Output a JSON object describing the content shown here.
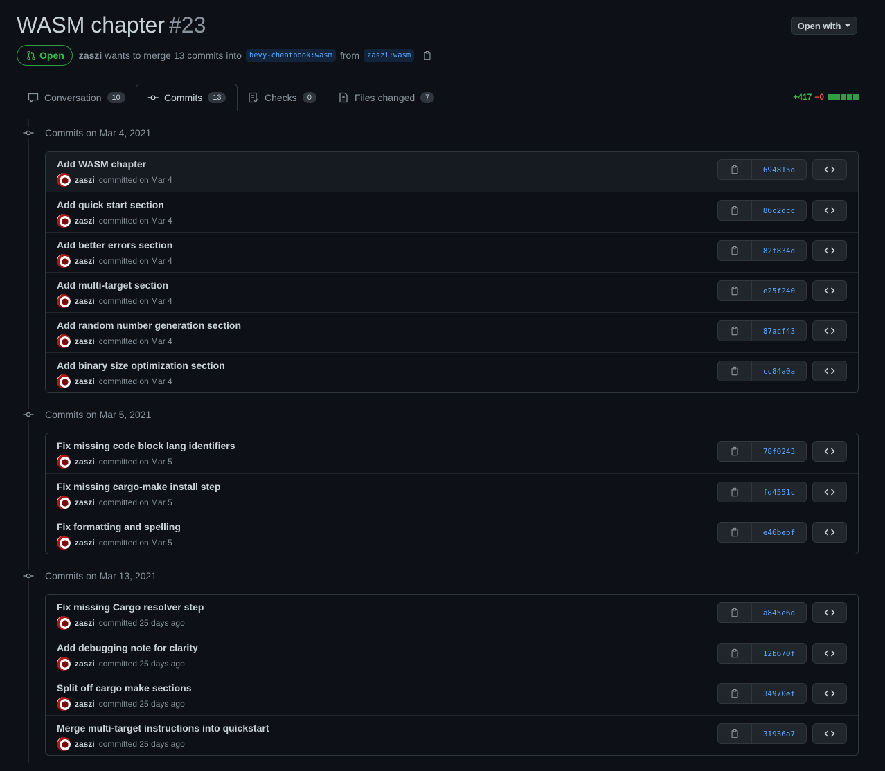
{
  "pr": {
    "title": "WASM chapter",
    "number": "#23",
    "state": "Open",
    "author": "zaszi",
    "merge_text": "wants to merge 13 commits into",
    "base_branch": "bevy-cheatbook:wasm",
    "from_text": "from",
    "head_branch": "zaszi:wasm"
  },
  "header": {
    "open_with_label": "Open with"
  },
  "tabs": [
    {
      "label": "Conversation",
      "count": "10",
      "icon": "comment-icon"
    },
    {
      "label": "Commits",
      "count": "13",
      "icon": "git-commit-icon"
    },
    {
      "label": "Checks",
      "count": "0",
      "icon": "checklist-icon"
    },
    {
      "label": "Files changed",
      "count": "7",
      "icon": "file-diff-icon"
    }
  ],
  "diffstat": {
    "additions": "+417",
    "deletions": "−0",
    "color_add": "#3fb950",
    "color_del": "#f85149"
  },
  "groups": [
    {
      "heading": "Commits on Mar 4, 2021",
      "commits": [
        {
          "message": "Add WASM chapter",
          "author": "zaszi",
          "time": "committed on Mar 4",
          "sha": "694815d"
        },
        {
          "message": "Add quick start section",
          "author": "zaszi",
          "time": "committed on Mar 4",
          "sha": "86c2dcc"
        },
        {
          "message": "Add better errors section",
          "author": "zaszi",
          "time": "committed on Mar 4",
          "sha": "82f834d"
        },
        {
          "message": "Add multi-target section",
          "author": "zaszi",
          "time": "committed on Mar 4",
          "sha": "e25f240"
        },
        {
          "message": "Add random number generation section",
          "author": "zaszi",
          "time": "committed on Mar 4",
          "sha": "87acf43"
        },
        {
          "message": "Add binary size optimization section",
          "author": "zaszi",
          "time": "committed on Mar 4",
          "sha": "cc84a0a"
        }
      ]
    },
    {
      "heading": "Commits on Mar 5, 2021",
      "commits": [
        {
          "message": "Fix missing code block lang identifiers",
          "author": "zaszi",
          "time": "committed on Mar 5",
          "sha": "78f0243"
        },
        {
          "message": "Fix missing cargo-make install step",
          "author": "zaszi",
          "time": "committed on Mar 5",
          "sha": "fd4551c"
        },
        {
          "message": "Fix formatting and spelling",
          "author": "zaszi",
          "time": "committed on Mar 5",
          "sha": "e46bebf"
        }
      ]
    },
    {
      "heading": "Commits on Mar 13, 2021",
      "commits": [
        {
          "message": "Fix missing Cargo resolver step",
          "author": "zaszi",
          "time": "committed 25 days ago",
          "sha": "a845e6d"
        },
        {
          "message": "Add debugging note for clarity",
          "author": "zaszi",
          "time": "committed 25 days ago",
          "sha": "12b670f"
        },
        {
          "message": "Split off cargo make sections",
          "author": "zaszi",
          "time": "committed 25 days ago",
          "sha": "34970ef"
        },
        {
          "message": "Merge multi-target instructions into quickstart",
          "author": "zaszi",
          "time": "committed 25 days ago",
          "sha": "31936a7"
        }
      ]
    }
  ]
}
